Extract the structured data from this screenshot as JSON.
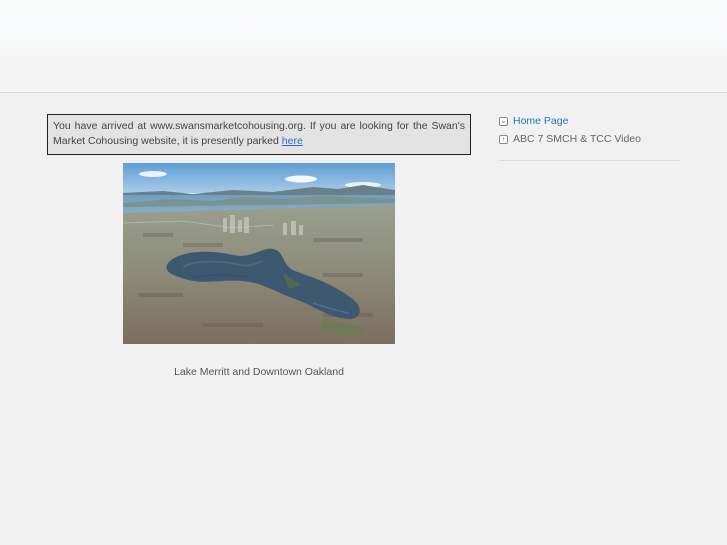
{
  "notice": {
    "text": "You have arrived at www.swansmarketcohousing.org. If you are looking for the Swan's Market Cohousing website, it is presently parked ",
    "link_text": "here"
  },
  "photo": {
    "caption": "Lake Merritt and Downtown Oakland"
  },
  "sidebar": {
    "items": [
      {
        "label": "Home Page",
        "icon": "chevron-down-icon",
        "active": true
      },
      {
        "label": "ABC 7 SMCH & TCC Video",
        "icon": "chevron-right-icon",
        "active": false
      }
    ]
  },
  "colors": {
    "link": "#2a72b8",
    "page_background": "#f1f1f1",
    "notice_background": "#e3e3e3"
  }
}
